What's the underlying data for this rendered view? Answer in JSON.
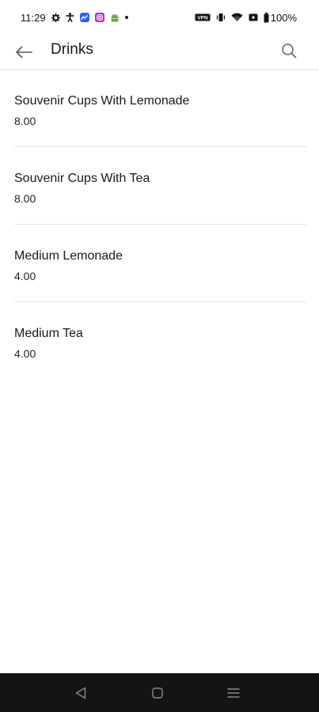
{
  "status_bar": {
    "time": "11:29",
    "battery": "100%",
    "icons": [
      "settings-icon",
      "accessibility-icon",
      "messenger-icon",
      "instagram-icon",
      "android-icon",
      "notification-dot",
      "vpn-icon",
      "vibrate-icon",
      "wifi-icon",
      "battery-icon"
    ]
  },
  "app_bar": {
    "title": "Drinks",
    "back_icon": "arrow-left-icon",
    "search_icon": "search-icon"
  },
  "items": [
    {
      "name": "Souvenir Cups With Lemonade",
      "price": "8.00"
    },
    {
      "name": "Souvenir Cups With Tea",
      "price": "8.00"
    },
    {
      "name": "Medium Lemonade",
      "price": "4.00"
    },
    {
      "name": "Medium Tea",
      "price": "4.00"
    }
  ],
  "nav_bar": {
    "icons": [
      "back-triangle-icon",
      "home-square-icon",
      "recents-menu-icon"
    ]
  },
  "colors": {
    "nav_background": "#141414",
    "divider": "#e4e4e4",
    "text": "#1a1a1a"
  }
}
